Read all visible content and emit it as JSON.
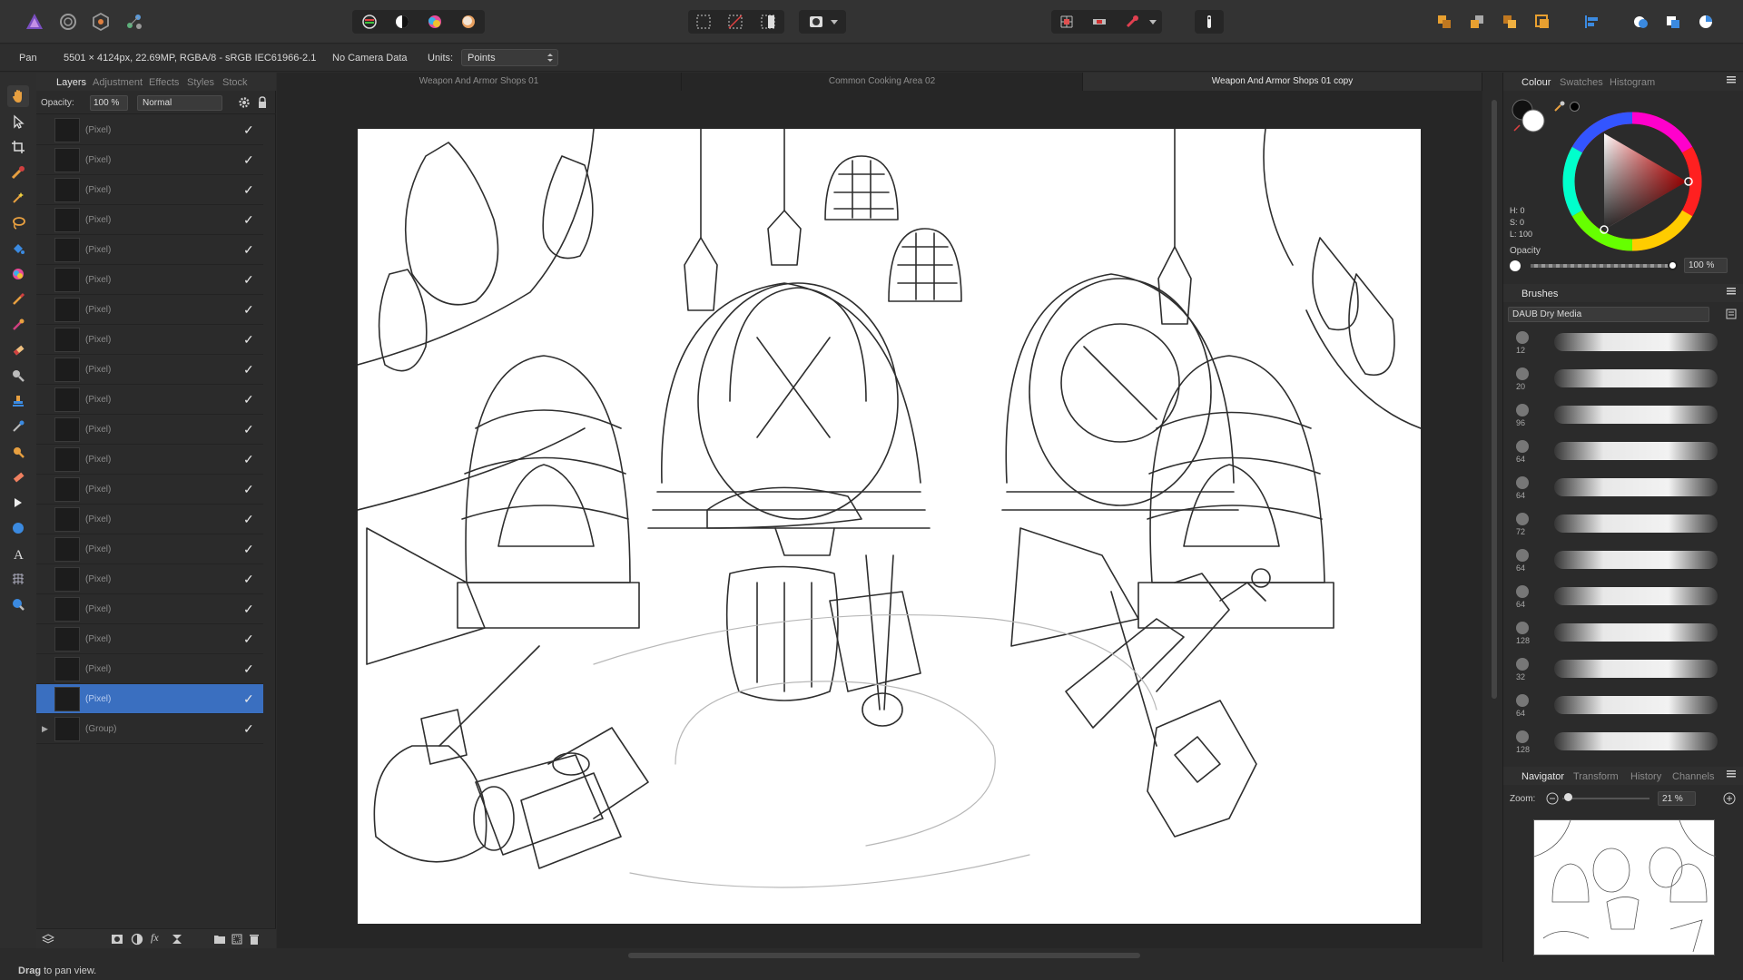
{
  "context": {
    "tool_name": "Pan",
    "doc_info": "5501 × 4124px, 22.69MP, RGBA/8 - sRGB IEC61966-2.1",
    "camera": "No Camera Data",
    "units_label": "Units:",
    "units_value": "Points"
  },
  "layers_panel": {
    "tabs": [
      "Layers",
      "Adjustment",
      "Effects",
      "Styles",
      "Stock"
    ],
    "opacity_label": "Opacity:",
    "opacity_value": "100 %",
    "blend_mode": "Normal",
    "rows": [
      "(Pixel)",
      "(Pixel)",
      "(Pixel)",
      "(Pixel)",
      "(Pixel)",
      "(Pixel)",
      "(Pixel)",
      "(Pixel)",
      "(Pixel)",
      "(Pixel)",
      "(Pixel)",
      "(Pixel)",
      "(Pixel)",
      "(Pixel)",
      "(Pixel)",
      "(Pixel)",
      "(Pixel)",
      "(Pixel)",
      "(Pixel)",
      "(Pixel)"
    ],
    "group_label": "(Group)",
    "selected_index": 19
  },
  "document_tabs": [
    "Weapon And Armor Shops 01",
    "Common Cooking Area 02",
    "Weapon And Armor Shops 01 copy"
  ],
  "active_document_tab": 2,
  "colour_panel": {
    "tabs": [
      "Colour",
      "Swatches",
      "Histogram"
    ],
    "h": "H: 0",
    "s": "S: 0",
    "l": "L: 100",
    "opacity_label": "Opacity",
    "opacity_value": "100 %"
  },
  "brushes_panel": {
    "title": "Brushes",
    "category": "DAUB Dry Media",
    "sizes": [
      "12",
      "20",
      "96",
      "64",
      "64",
      "72",
      "64",
      "64",
      "128",
      "32",
      "64",
      "128"
    ]
  },
  "navigator_panel": {
    "tabs": [
      "Navigator",
      "Transform",
      "History",
      "Channels"
    ],
    "zoom_label": "Zoom:",
    "zoom_value": "21 %"
  },
  "status": {
    "bold": "Drag",
    "rest": " to pan view."
  },
  "colors": {
    "accent": "#3a6fc0",
    "app_bg": "#2b2b2b"
  }
}
